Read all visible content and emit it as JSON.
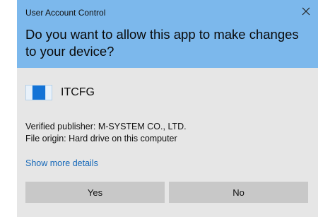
{
  "dialog": {
    "window_title": "User Account Control",
    "question": "Do you want to allow this app to make changes to your device?",
    "app_name": "ITCFG",
    "publisher_line": "Verified publisher: M-SYSTEM CO., LTD.",
    "origin_line": "File origin: Hard drive on this computer",
    "more_details_label": "Show more details",
    "yes_label": "Yes",
    "no_label": "No",
    "close_icon": "close-icon",
    "app_icon": "app-window-icon"
  },
  "colors": {
    "header": "#7cb8ec",
    "body": "#e6e6e6",
    "button": "#c8c8c8",
    "link": "#1467b8"
  }
}
